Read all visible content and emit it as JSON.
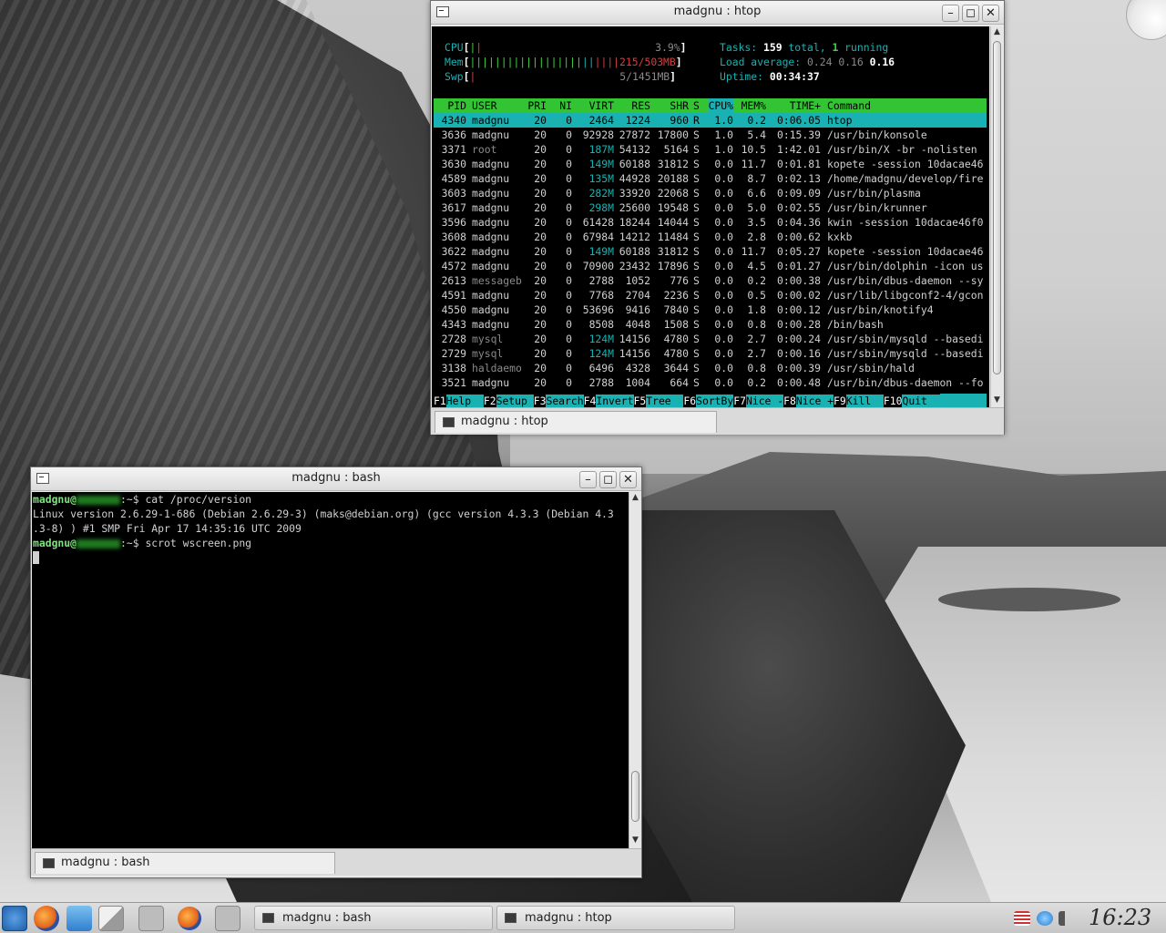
{
  "htop_window": {
    "title": "madgnu : htop",
    "tab_label": "madgnu : htop",
    "meters": {
      "cpu_label": "CPU",
      "cpu_value": "3.9%",
      "mem_label": "Mem",
      "mem_value": "215/503MB",
      "swp_label": "Swp",
      "swp_value": "5/1451MB",
      "tasks_prefix": "Tasks: ",
      "tasks_total": "159",
      "tasks_mid": " total, ",
      "tasks_running": "1",
      "tasks_suffix": " running",
      "load_prefix": "Load average: ",
      "load_1": "0.24",
      "load_5": "0.16",
      "load_15": "0.16",
      "uptime_prefix": "Uptime: ",
      "uptime": "00:34:37"
    },
    "columns": [
      "PID",
      "USER",
      "PRI",
      "NI",
      "VIRT",
      "RES",
      "SHR",
      "S",
      "CPU%",
      "MEM%",
      "TIME+",
      "Command"
    ],
    "processes": [
      {
        "pid": "4340",
        "user": "madgnu",
        "pri": "20",
        "ni": "0",
        "virt": "2464",
        "res": "1224",
        "shr": "960",
        "s": "R",
        "cpu": "1.0",
        "mem": "0.2",
        "time": "0:06.05",
        "cmd": "htop"
      },
      {
        "pid": "3636",
        "user": "madgnu",
        "pri": "20",
        "ni": "0",
        "virt": "92928",
        "res": "27872",
        "shr": "17800",
        "s": "S",
        "cpu": "1.0",
        "mem": "5.4",
        "time": "0:15.39",
        "cmd": "/usr/bin/konsole"
      },
      {
        "pid": "3371",
        "user": "root",
        "pri": "20",
        "ni": "0",
        "virt": "187M",
        "res": "54132",
        "shr": "5164",
        "s": "S",
        "cpu": "1.0",
        "mem": "10.5",
        "time": "1:42.01",
        "cmd": "/usr/bin/X -br -nolisten"
      },
      {
        "pid": "3630",
        "user": "madgnu",
        "pri": "20",
        "ni": "0",
        "virt": "149M",
        "res": "60188",
        "shr": "31812",
        "s": "S",
        "cpu": "0.0",
        "mem": "11.7",
        "time": "0:01.81",
        "cmd": "kopete -session 10dacae46"
      },
      {
        "pid": "4589",
        "user": "madgnu",
        "pri": "20",
        "ni": "0",
        "virt": "135M",
        "res": "44928",
        "shr": "20188",
        "s": "S",
        "cpu": "0.0",
        "mem": "8.7",
        "time": "0:02.13",
        "cmd": "/home/madgnu/develop/fire"
      },
      {
        "pid": "3603",
        "user": "madgnu",
        "pri": "20",
        "ni": "0",
        "virt": "282M",
        "res": "33920",
        "shr": "22068",
        "s": "S",
        "cpu": "0.0",
        "mem": "6.6",
        "time": "0:09.09",
        "cmd": "/usr/bin/plasma"
      },
      {
        "pid": "3617",
        "user": "madgnu",
        "pri": "20",
        "ni": "0",
        "virt": "298M",
        "res": "25600",
        "shr": "19548",
        "s": "S",
        "cpu": "0.0",
        "mem": "5.0",
        "time": "0:02.55",
        "cmd": "/usr/bin/krunner"
      },
      {
        "pid": "3596",
        "user": "madgnu",
        "pri": "20",
        "ni": "0",
        "virt": "61428",
        "res": "18244",
        "shr": "14044",
        "s": "S",
        "cpu": "0.0",
        "mem": "3.5",
        "time": "0:04.36",
        "cmd": "kwin -session 10dacae46f0"
      },
      {
        "pid": "3608",
        "user": "madgnu",
        "pri": "20",
        "ni": "0",
        "virt": "67984",
        "res": "14212",
        "shr": "11484",
        "s": "S",
        "cpu": "0.0",
        "mem": "2.8",
        "time": "0:00.62",
        "cmd": "kxkb"
      },
      {
        "pid": "3622",
        "user": "madgnu",
        "pri": "20",
        "ni": "0",
        "virt": "149M",
        "res": "60188",
        "shr": "31812",
        "s": "S",
        "cpu": "0.0",
        "mem": "11.7",
        "time": "0:05.27",
        "cmd": "kopete -session 10dacae46"
      },
      {
        "pid": "4572",
        "user": "madgnu",
        "pri": "20",
        "ni": "0",
        "virt": "70900",
        "res": "23432",
        "shr": "17896",
        "s": "S",
        "cpu": "0.0",
        "mem": "4.5",
        "time": "0:01.27",
        "cmd": "/usr/bin/dolphin -icon us"
      },
      {
        "pid": "2613",
        "user": "messageb",
        "pri": "20",
        "ni": "0",
        "virt": "2788",
        "res": "1052",
        "shr": "776",
        "s": "S",
        "cpu": "0.0",
        "mem": "0.2",
        "time": "0:00.38",
        "cmd": "/usr/bin/dbus-daemon --sy"
      },
      {
        "pid": "4591",
        "user": "madgnu",
        "pri": "20",
        "ni": "0",
        "virt": "7768",
        "res": "2704",
        "shr": "2236",
        "s": "S",
        "cpu": "0.0",
        "mem": "0.5",
        "time": "0:00.02",
        "cmd": "/usr/lib/libgconf2-4/gcon"
      },
      {
        "pid": "4550",
        "user": "madgnu",
        "pri": "20",
        "ni": "0",
        "virt": "53696",
        "res": "9416",
        "shr": "7840",
        "s": "S",
        "cpu": "0.0",
        "mem": "1.8",
        "time": "0:00.12",
        "cmd": "/usr/bin/knotify4"
      },
      {
        "pid": "4343",
        "user": "madgnu",
        "pri": "20",
        "ni": "0",
        "virt": "8508",
        "res": "4048",
        "shr": "1508",
        "s": "S",
        "cpu": "0.0",
        "mem": "0.8",
        "time": "0:00.28",
        "cmd": "/bin/bash"
      },
      {
        "pid": "2728",
        "user": "mysql",
        "pri": "20",
        "ni": "0",
        "virt": "124M",
        "res": "14156",
        "shr": "4780",
        "s": "S",
        "cpu": "0.0",
        "mem": "2.7",
        "time": "0:00.24",
        "cmd": "/usr/sbin/mysqld --basedi"
      },
      {
        "pid": "2729",
        "user": "mysql",
        "pri": "20",
        "ni": "0",
        "virt": "124M",
        "res": "14156",
        "shr": "4780",
        "s": "S",
        "cpu": "0.0",
        "mem": "2.7",
        "time": "0:00.16",
        "cmd": "/usr/sbin/mysqld --basedi"
      },
      {
        "pid": "3138",
        "user": "haldaemo",
        "pri": "20",
        "ni": "0",
        "virt": "6496",
        "res": "4328",
        "shr": "3644",
        "s": "S",
        "cpu": "0.0",
        "mem": "0.8",
        "time": "0:00.39",
        "cmd": "/usr/sbin/hald"
      },
      {
        "pid": "3521",
        "user": "madgnu",
        "pri": "20",
        "ni": "0",
        "virt": "2788",
        "res": "1004",
        "shr": "664",
        "s": "S",
        "cpu": "0.0",
        "mem": "0.2",
        "time": "0:00.48",
        "cmd": "/usr/bin/dbus-daemon --fo"
      }
    ],
    "function_keys": [
      {
        "key": "F1",
        "label": "Help  "
      },
      {
        "key": "F2",
        "label": "Setup "
      },
      {
        "key": "F3",
        "label": "Search"
      },
      {
        "key": "F4",
        "label": "Invert"
      },
      {
        "key": "F5",
        "label": "Tree  "
      },
      {
        "key": "F6",
        "label": "SortBy"
      },
      {
        "key": "F7",
        "label": "Nice -"
      },
      {
        "key": "F8",
        "label": "Nice +"
      },
      {
        "key": "F9",
        "label": "Kill  "
      },
      {
        "key": "F10",
        "label": "Quit  "
      }
    ]
  },
  "bash_window": {
    "title": "madgnu : bash",
    "tab_label": "madgnu : bash",
    "prompt_user": "madgnu@",
    "prompt_suffix": ":~$ ",
    "lines": [
      {
        "type": "prompt",
        "cmd": "cat /proc/version"
      },
      {
        "type": "output",
        "text": "Linux version 2.6.29-1-686 (Debian 2.6.29-3) (maks@debian.org) (gcc version 4.3.3 (Debian 4.3"
      },
      {
        "type": "output",
        "text": ".3-8) ) #1 SMP Fri Apr 17 14:35:16 UTC 2009"
      },
      {
        "type": "prompt",
        "cmd": "scrot wscreen.png"
      }
    ]
  },
  "taskbar": {
    "tasks": [
      "madgnu : bash",
      "madgnu : htop"
    ],
    "clock": "16:23"
  },
  "colors": {
    "htop_header_bg": "#33c433",
    "htop_selected_bg": "#19b1b1",
    "htop_cyan": "#17b2b2",
    "prompt_green": "#7ee27e"
  }
}
